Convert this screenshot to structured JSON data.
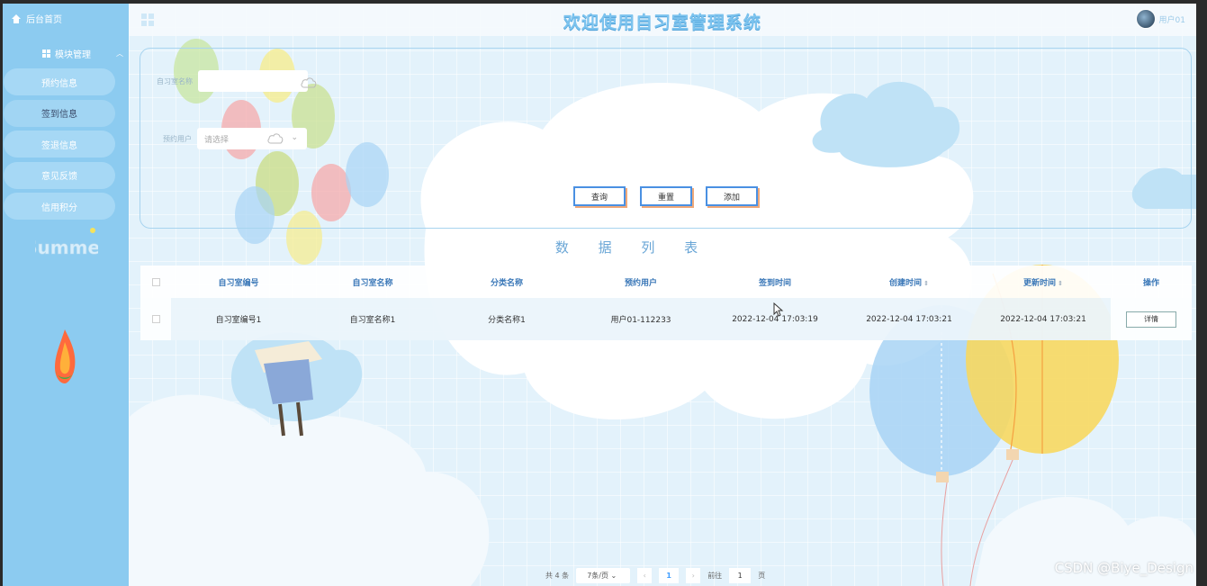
{
  "sidebar": {
    "home_label": "后台首页",
    "group_label": "模块管理",
    "items": [
      {
        "label": "预约信息"
      },
      {
        "label": "签到信息"
      },
      {
        "label": "签退信息"
      },
      {
        "label": "意见反馈"
      },
      {
        "label": "信用积分"
      }
    ],
    "active_index": 1
  },
  "header": {
    "title": "欢迎使用自习室管理系统",
    "user_name": "用户01"
  },
  "search": {
    "room_name_label": "自习室名称",
    "room_name_value": "",
    "user_label": "预约用户",
    "user_placeholder": "请选择",
    "buttons": {
      "query": "查询",
      "reset": "重置",
      "add": "添加"
    }
  },
  "list_title": "数 据 列 表",
  "table": {
    "columns": [
      "自习室编号",
      "自习室名称",
      "分类名称",
      "预约用户",
      "签到时间",
      "创建时间",
      "更新时间",
      "操作"
    ],
    "rows": [
      {
        "room_no": "自习室编号1",
        "room_name": "自习室名称1",
        "category": "分类名称1",
        "user": "用户01-112233",
        "checkin_time": "2022-12-04 17:03:19",
        "created_time": "2022-12-04 17:03:21",
        "updated_time": "2022-12-04 17:03:21",
        "action": "详情"
      }
    ]
  },
  "pagination": {
    "total_text": "共 4 条",
    "page_size": "7条/页",
    "current_page": "1",
    "goto_label": "前往",
    "goto_value": "1",
    "page_suffix": "页"
  },
  "watermark": "CSDN @Biye_Design",
  "colors": {
    "sidebar_bg": "#8ccbf0",
    "title": "#7cc3ee",
    "button_border": "#4a90e2",
    "header_text": "#3b78b8"
  }
}
